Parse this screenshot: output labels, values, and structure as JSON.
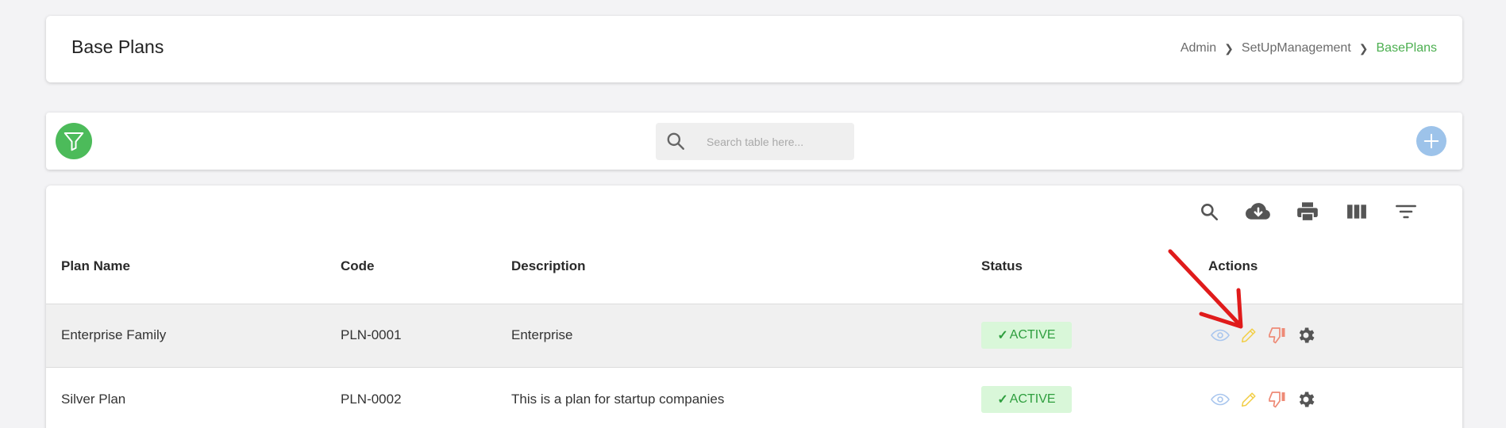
{
  "page": {
    "title": "Base Plans"
  },
  "breadcrumb": {
    "items": [
      "Admin",
      "SetUpManagement",
      "BasePlans"
    ]
  },
  "toolbar": {
    "search_placeholder": "Search table here..."
  },
  "table": {
    "columns": [
      "Plan Name",
      "Code",
      "Description",
      "Status",
      "Actions"
    ],
    "rows": [
      {
        "name": "Enterprise Family",
        "code": "PLN-0001",
        "description": "Enterprise",
        "status": "ACTIVE"
      },
      {
        "name": "Silver Plan",
        "code": "PLN-0002",
        "description": "This is a plan for startup companies",
        "status": "ACTIVE"
      }
    ]
  },
  "icons": {
    "filter": "filter-icon",
    "search": "search-icon",
    "add": "plus-icon",
    "download": "cloud-download-icon",
    "print": "printer-icon",
    "columns": "view-column-icon",
    "filter_list": "filter-list-icon",
    "view": "eye-icon",
    "edit": "pencil-icon",
    "deactivate": "thumbs-down-icon",
    "settings": "gear-icon"
  },
  "colors": {
    "accent": "#4caf50",
    "filter_button": "#4cbb5a",
    "add_button": "#9dc3ea",
    "status_bg": "#d9f7d9",
    "status_text": "#2e9e3e",
    "annotation_arrow": "#e01b1b"
  }
}
